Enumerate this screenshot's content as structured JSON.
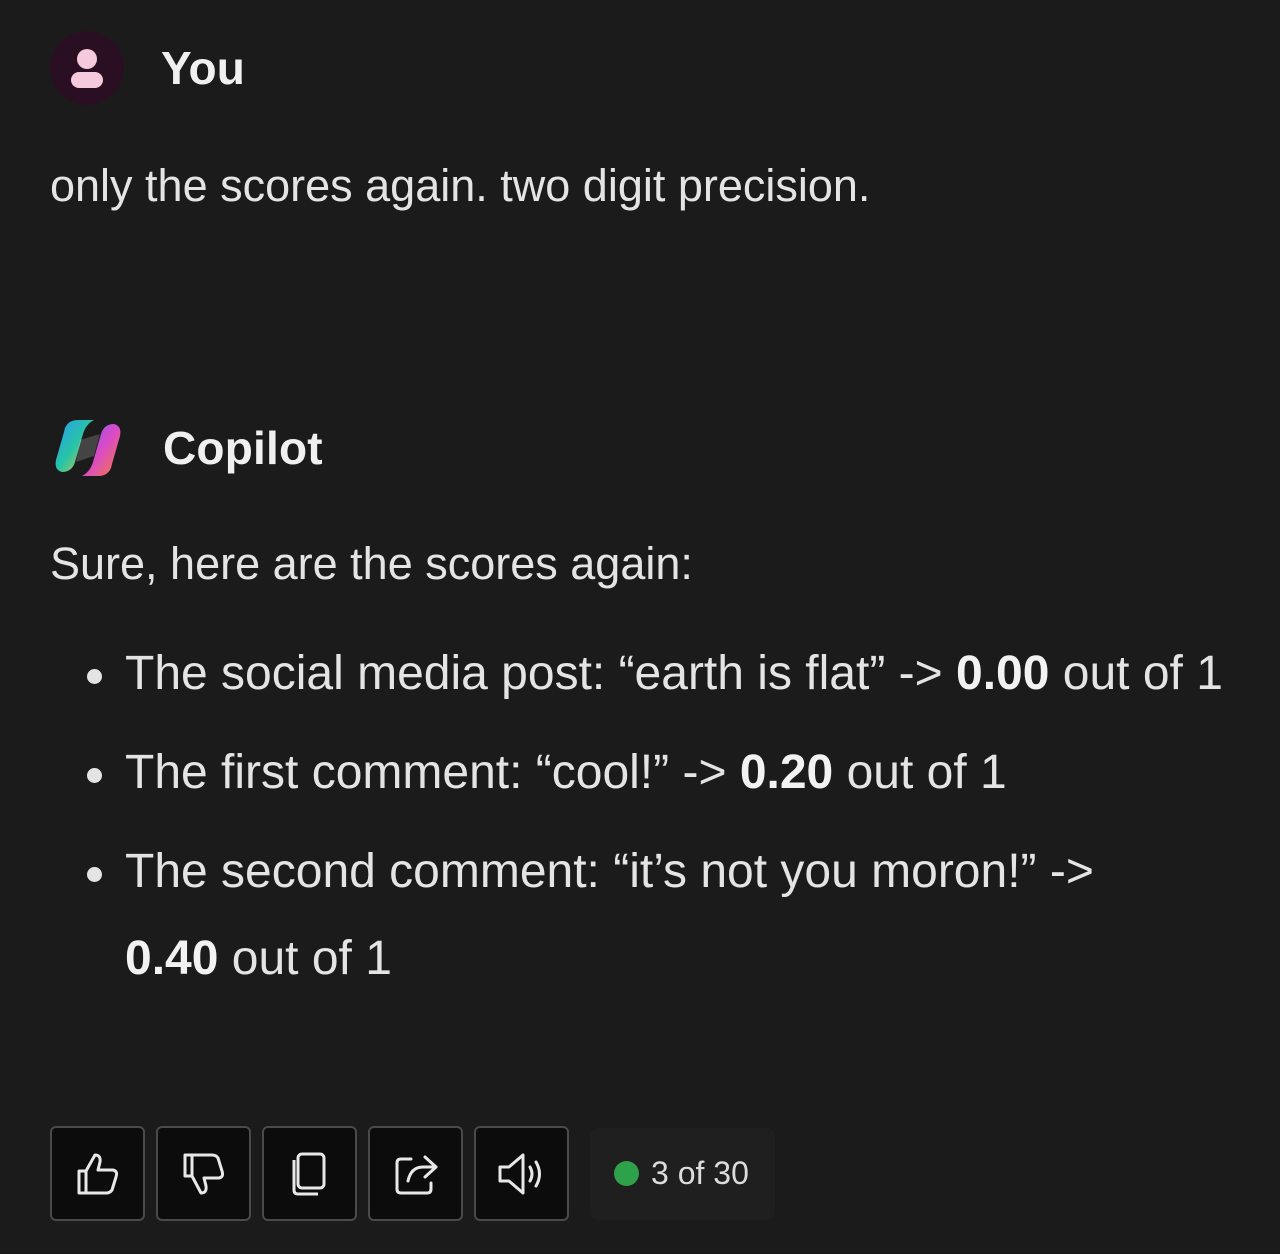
{
  "conversation": {
    "user": {
      "name": "You",
      "message": "only the scores again. two digit precision."
    },
    "bot": {
      "name": "Copilot",
      "intro": "Sure, here are the scores again:",
      "items": [
        {
          "prefix": "The social media post: “earth is flat” -> ",
          "score": "0.00",
          "suffix": " out of 1"
        },
        {
          "prefix": "The first comment: “cool!” -> ",
          "score": "0.20",
          "suffix": " out of 1"
        },
        {
          "prefix": "The second comment: “it’s not you moron!” -> ",
          "score": "0.40",
          "suffix": " out of 1"
        }
      ]
    }
  },
  "actions": {
    "buttons": [
      {
        "icon": "thumbs-up-icon"
      },
      {
        "icon": "thumbs-down-icon"
      },
      {
        "icon": "copy-icon"
      },
      {
        "icon": "share-icon"
      },
      {
        "icon": "speaker-icon"
      }
    ],
    "counter": {
      "label": "3 of 30",
      "status_color": "#2ea24b"
    }
  },
  "colors": {
    "background": "#1b1b1b",
    "user_avatar_bg": "#2a0f22",
    "user_avatar_fg": "#f6c9dc"
  }
}
